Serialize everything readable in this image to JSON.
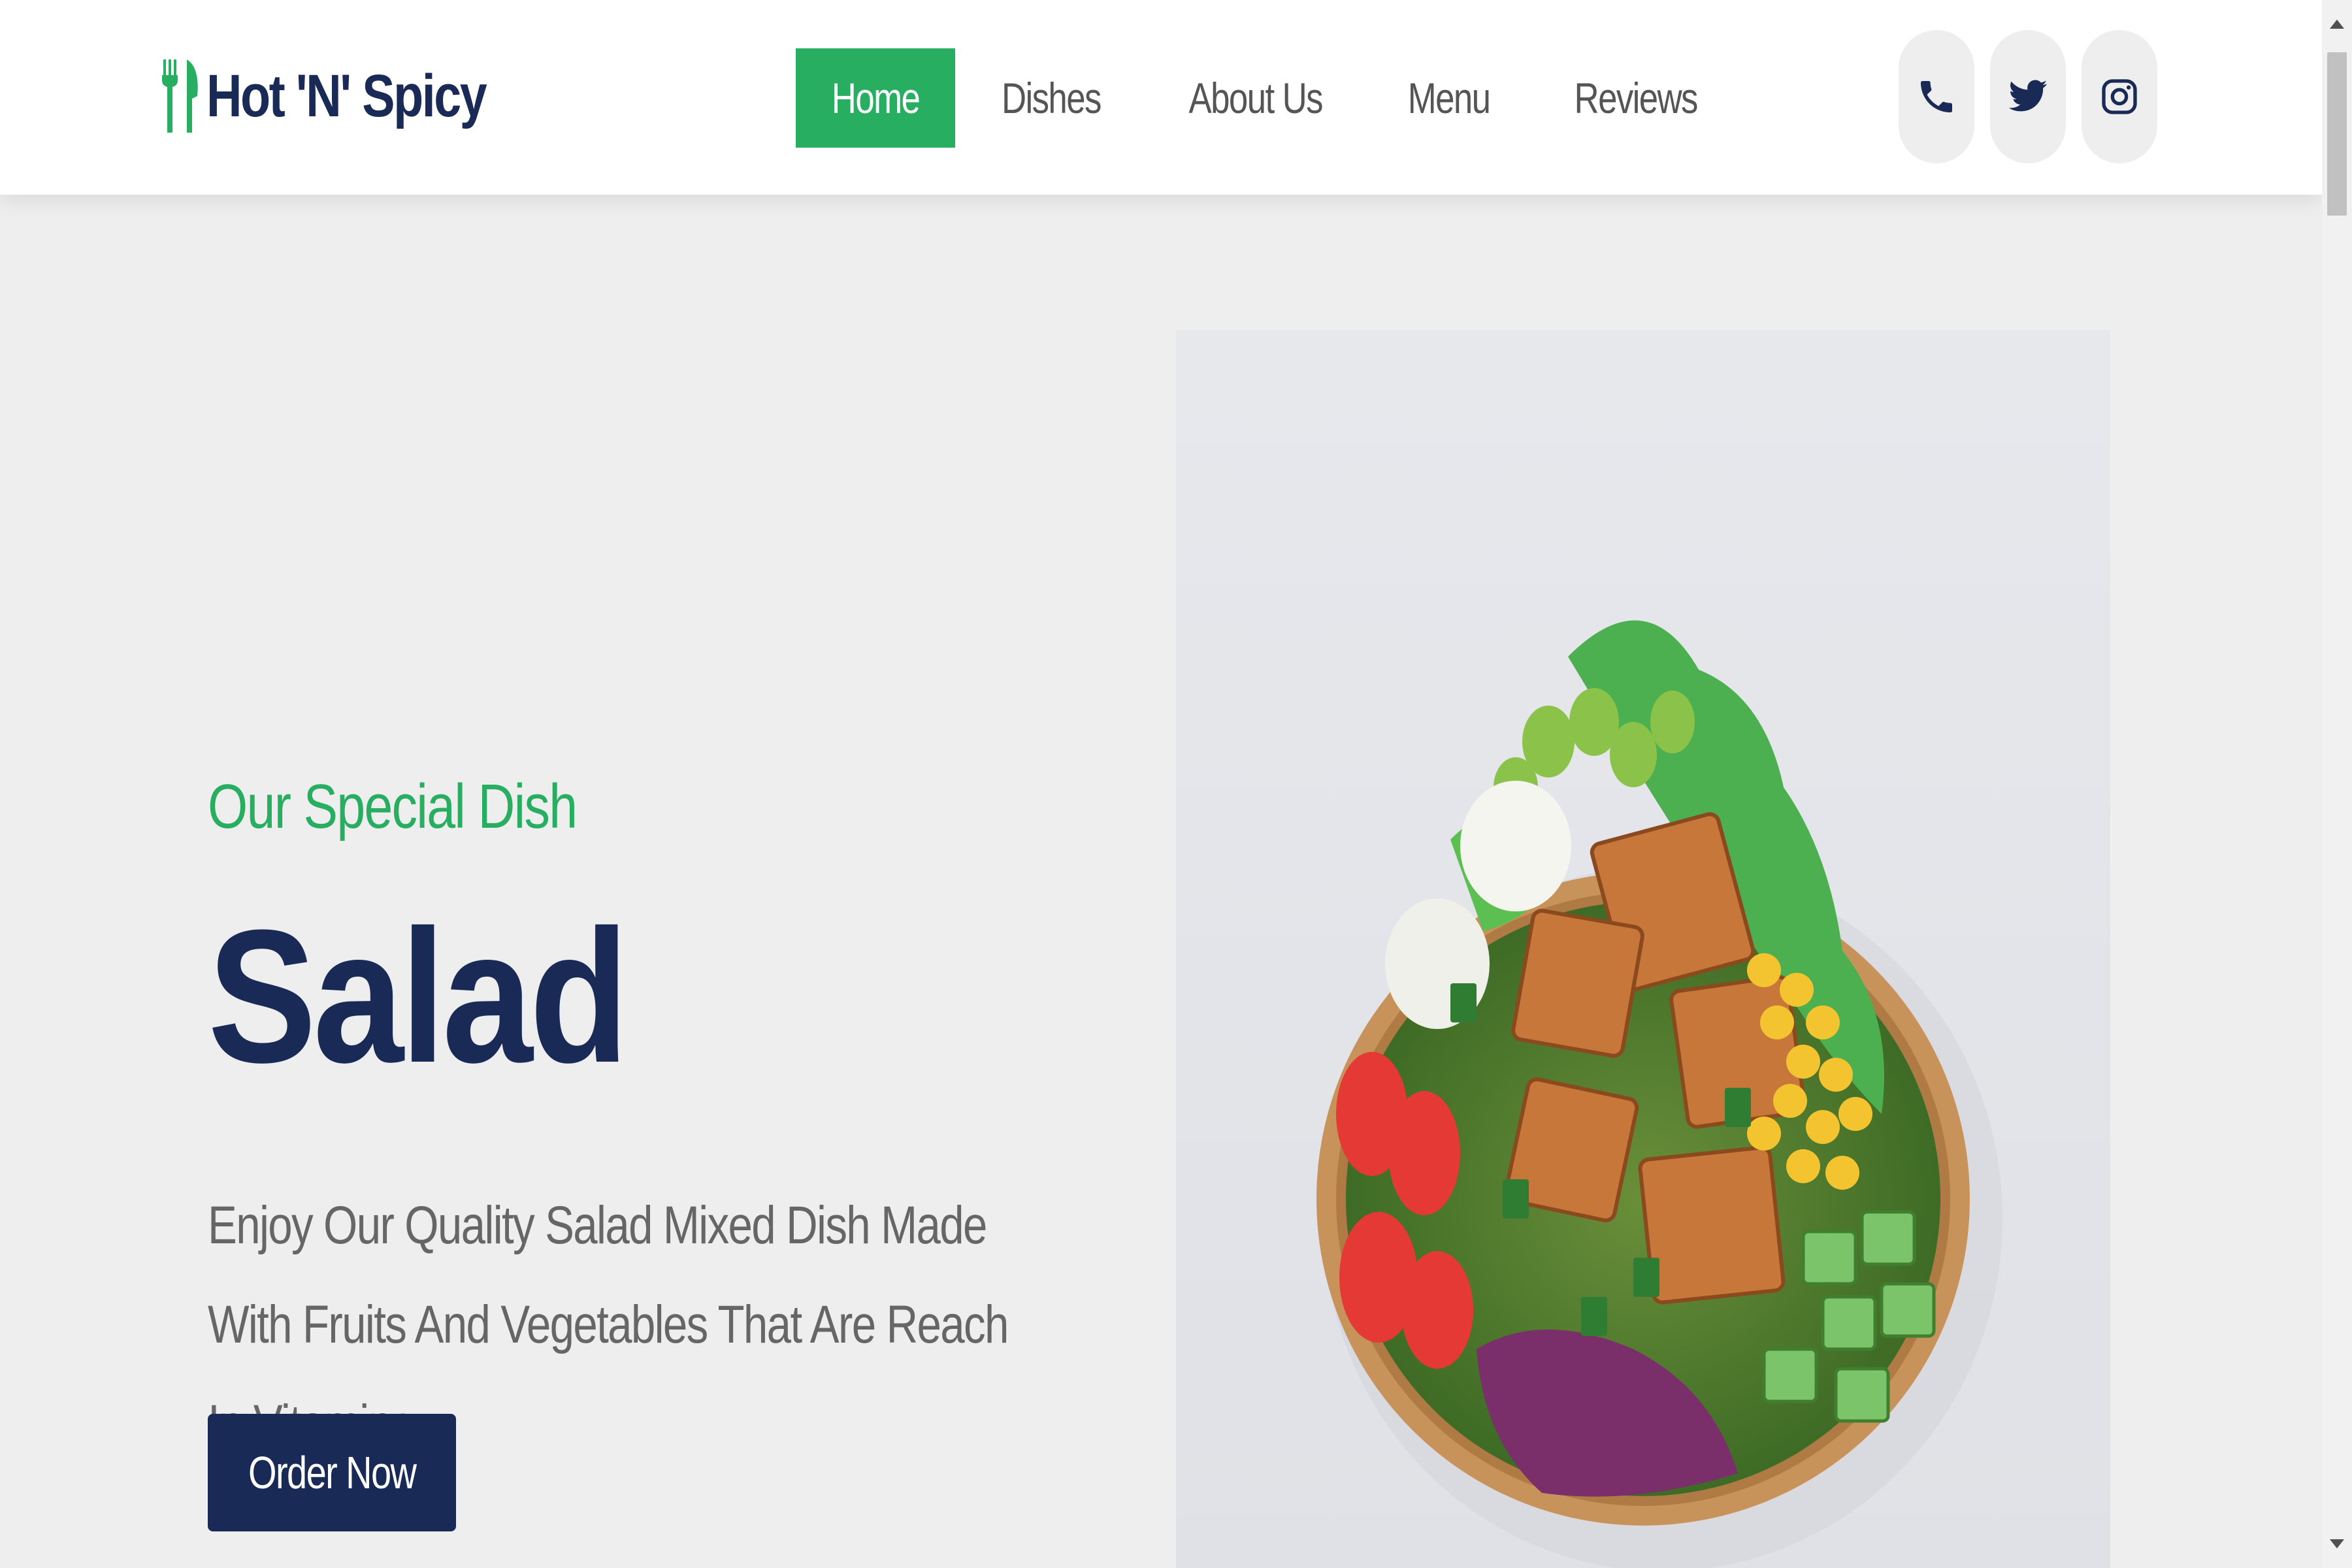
{
  "header": {
    "logo_text": "Hot 'N' Spicy",
    "nav": [
      {
        "label": "Home",
        "active": true
      },
      {
        "label": "Dishes",
        "active": false
      },
      {
        "label": "About Us",
        "active": false
      },
      {
        "label": "Menu",
        "active": false
      },
      {
        "label": "Reviews",
        "active": false
      }
    ],
    "social_icons": [
      "phone-icon",
      "twitter-icon",
      "instagram-icon"
    ]
  },
  "hero": {
    "subtitle": "Our Special Dish",
    "title": "Salad",
    "description": "Enjoy Our Quality Salad Mixed Dish Made With Fruits And Vegetables That Are Reach In Vitamins.",
    "button_label": "Order Now",
    "image": "salad-bowl-image"
  },
  "colors": {
    "accent": "#27ae60",
    "brand_dark": "#192a56",
    "background": "#eeeeef"
  }
}
